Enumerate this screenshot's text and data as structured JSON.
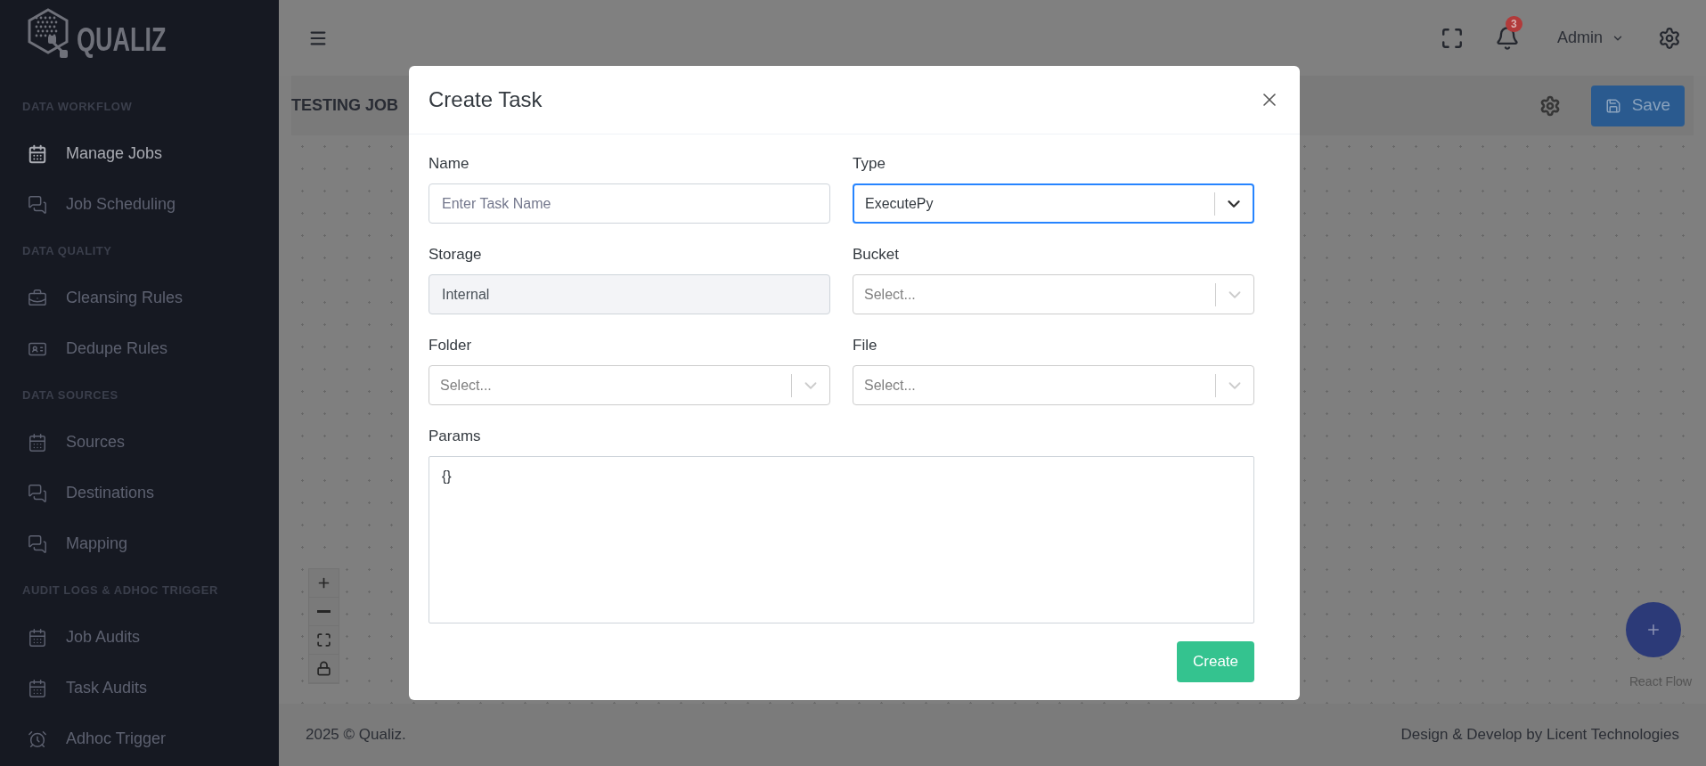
{
  "sidebar": {
    "logo": "QUALIZ",
    "sections": [
      {
        "title": "DATA WORKFLOW",
        "items": [
          {
            "label": "Manage Jobs",
            "selected": true
          },
          {
            "label": "Job Scheduling",
            "selected": false
          }
        ]
      },
      {
        "title": "DATA QUALITY",
        "items": [
          {
            "label": "Cleansing Rules",
            "selected": false
          },
          {
            "label": "Dedupe Rules",
            "selected": false
          }
        ]
      },
      {
        "title": "DATA SOURCES",
        "items": [
          {
            "label": "Sources",
            "selected": false
          },
          {
            "label": "Destinations",
            "selected": false
          },
          {
            "label": "Mapping",
            "selected": false
          }
        ]
      },
      {
        "title": "AUDIT LOGS & ADHOC TRIGGER",
        "items": [
          {
            "label": "Job Audits",
            "selected": false
          },
          {
            "label": "Task Audits",
            "selected": false
          },
          {
            "label": "Adhoc Trigger",
            "selected": false
          }
        ]
      }
    ]
  },
  "topbar": {
    "notifications": "3",
    "user": "Admin"
  },
  "job": {
    "title": "TESTING JOB",
    "save": "Save"
  },
  "canvas": {
    "attribution": "React Flow"
  },
  "footer": {
    "left": "2025 © Qualiz.",
    "right": "Design & Develop by Licent Technologies"
  },
  "modal": {
    "title": "Create Task",
    "submit": "Create",
    "fields": [
      {
        "kind": "text",
        "label": "Name",
        "placeholder": "Enter Task Name"
      },
      {
        "kind": "select",
        "label": "Type",
        "value": "ExecutePy",
        "focused": true
      },
      {
        "kind": "readonly",
        "label": "Storage",
        "value": "Internal"
      },
      {
        "kind": "select",
        "label": "Bucket",
        "placeholder": "Select...",
        "focused": false
      },
      {
        "kind": "select",
        "label": "Folder",
        "placeholder": "Select...",
        "focused": false
      },
      {
        "kind": "select",
        "label": "File",
        "placeholder": "Select...",
        "focused": false
      },
      {
        "kind": "textarea",
        "label": "Params",
        "value": "{}"
      }
    ]
  }
}
